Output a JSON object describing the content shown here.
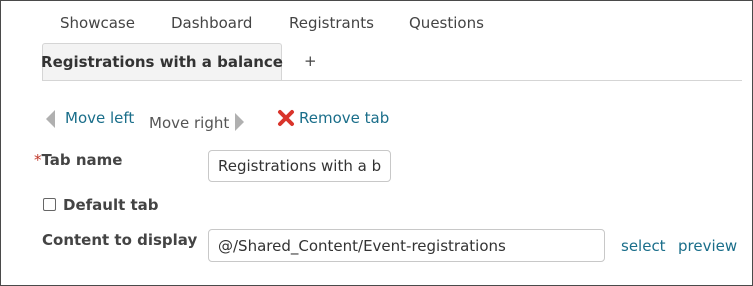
{
  "tabs": {
    "top": [
      "Showcase",
      "Dashboard",
      "Registrants",
      "Questions"
    ],
    "active": "Registrations with a balance",
    "add": "+"
  },
  "actions": {
    "move_left": "Move left",
    "move_right": "Move right",
    "remove_tab": "Remove tab"
  },
  "form": {
    "required_mark": "*",
    "tab_name_label": "Tab name",
    "tab_name_value": "Registrations with a bal",
    "default_tab_label": "Default tab",
    "default_tab_checked": false,
    "content_label": "Content to display",
    "content_value": "@/Shared_Content/Event-registrations",
    "select_link": "select",
    "preview_link": "preview"
  },
  "colors": {
    "link": "#1a6e8a",
    "remove_icon": "#d9342b",
    "required": "#c0392b"
  }
}
